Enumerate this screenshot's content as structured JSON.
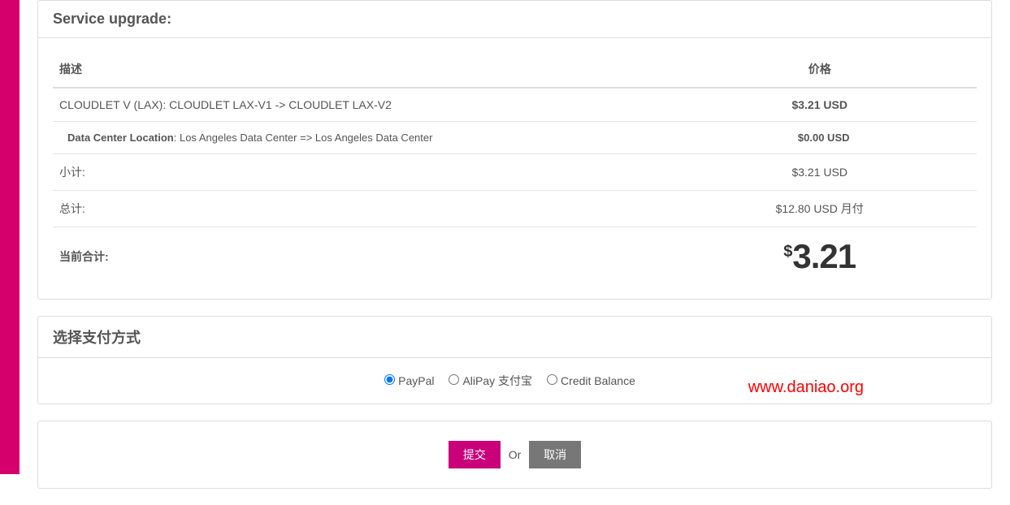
{
  "upgrade_panel": {
    "title": "Service upgrade:",
    "headers": {
      "description": "描述",
      "price": "价格"
    },
    "item": {
      "description": "CLOUDLET V (LAX): CLOUDLET LAX-V1 -> CLOUDLET LAX-V2",
      "price": "$3.21 USD"
    },
    "subitem": {
      "label": "Data Center Location",
      "value": ": Los Angeles Data Center => Los Angeles Data Center",
      "price": "$0.00 USD"
    },
    "subtotal": {
      "label": "小计:",
      "value": "$3.21 USD"
    },
    "total": {
      "label": "总计:",
      "value": "$12.80 USD 月付"
    },
    "current": {
      "label": "当前合计:",
      "currency": "$",
      "amount": "3.21"
    }
  },
  "payment_panel": {
    "title": "选择支付方式",
    "options": {
      "paypal": "PayPal",
      "alipay": "AliPay 支付宝",
      "credit": "Credit Balance"
    }
  },
  "actions": {
    "submit": "提交",
    "or": "Or",
    "cancel": "取消"
  },
  "watermark": "www.daniao.org"
}
